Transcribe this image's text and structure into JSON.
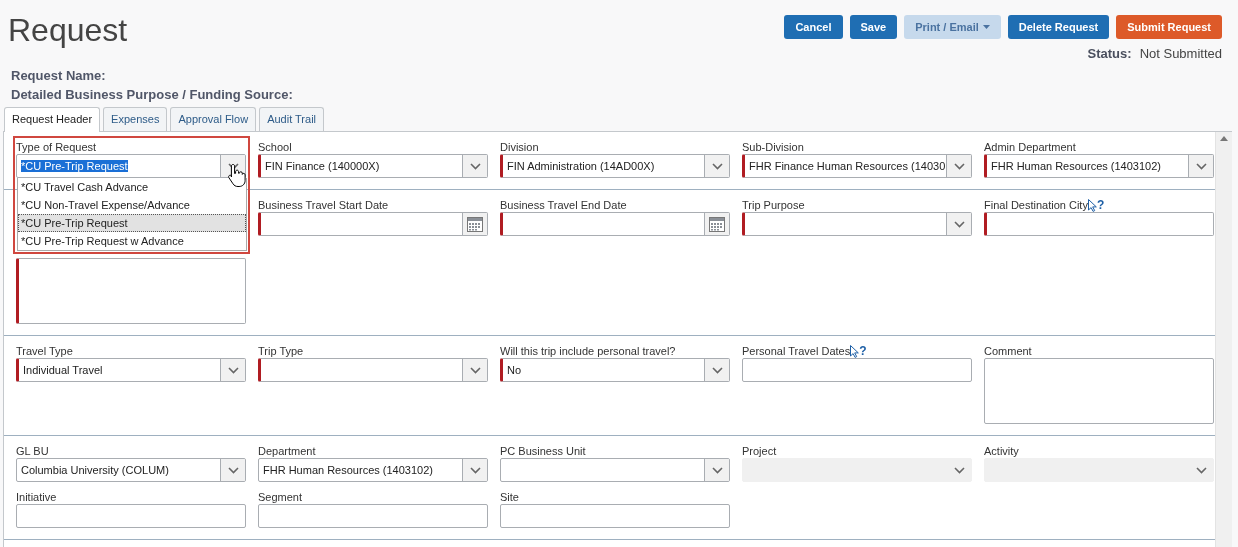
{
  "header": {
    "title": "Request",
    "buttons": [
      {
        "label": "Cancel",
        "kind": "primary",
        "disabled": false,
        "caret": false
      },
      {
        "label": "Save",
        "kind": "primary",
        "disabled": false,
        "caret": false
      },
      {
        "label": "Print / Email",
        "kind": "primary",
        "disabled": true,
        "caret": true
      },
      {
        "label": "Delete Request",
        "kind": "primary",
        "disabled": false,
        "caret": false
      },
      {
        "label": "Submit Request",
        "kind": "danger",
        "disabled": false,
        "caret": false
      }
    ],
    "status_label": "Status:",
    "status_value": "Not Submitted"
  },
  "info": [
    "Request Name:",
    "Detailed Business Purpose / Funding Source:"
  ],
  "tabs": [
    {
      "label": "Request Header",
      "selected": true
    },
    {
      "label": "Expenses",
      "selected": false
    },
    {
      "label": "Approval Flow",
      "selected": false
    },
    {
      "label": "Audit Trail",
      "selected": false
    }
  ],
  "sections": [
    {
      "fields": [
        {
          "kind": "select",
          "label": "Type of Request",
          "value": "*CU Pre-Trip Request",
          "required": false,
          "disabled": false,
          "expanded": true,
          "options": [
            {
              "label": "*CU Travel Cash Advance",
              "selected": false
            },
            {
              "label": "*CU Non-Travel Expense/Advance",
              "selected": false
            },
            {
              "label": "*CU Pre-Trip Request",
              "selected": true
            },
            {
              "label": "*CU Pre-Trip Request w Advance",
              "selected": false
            }
          ]
        },
        {
          "kind": "select",
          "label": "School",
          "value": "FIN Finance (140000X)",
          "required": true,
          "disabled": false
        },
        {
          "kind": "select",
          "label": "Division",
          "value": "FIN Administration (14AD00X)",
          "required": true,
          "disabled": false
        },
        {
          "kind": "select",
          "label": "Sub-Division",
          "value": "FHR Finance Human Resources (14030",
          "required": true,
          "disabled": false
        },
        {
          "kind": "select",
          "label": "Admin Department",
          "value": "FHR Human Resources (1403102)",
          "required": true,
          "disabled": false
        }
      ]
    },
    {
      "fields": [
        {
          "kind": "blank"
        },
        {
          "kind": "date",
          "label": "Business Travel Start Date",
          "required": true,
          "disabled": false
        },
        {
          "kind": "date",
          "label": "Business Travel End Date",
          "required": true,
          "disabled": false
        },
        {
          "kind": "select",
          "label": "Trip Purpose",
          "required": true,
          "disabled": false
        },
        {
          "kind": "text",
          "label": "Final Destination City",
          "help": "?",
          "required": true,
          "disabled": false
        },
        {
          "kind": "textarea",
          "required": true,
          "disabled": false
        }
      ]
    },
    {
      "fields": [
        {
          "kind": "select",
          "label": "Travel Type",
          "value": "Individual Travel",
          "required": true,
          "disabled": false
        },
        {
          "kind": "select",
          "label": "Trip Type",
          "required": true,
          "disabled": false
        },
        {
          "kind": "select",
          "label": "Will this trip include personal travel?",
          "value": "No",
          "required": true,
          "disabled": false
        },
        {
          "kind": "text",
          "label": "Personal Travel Dates",
          "help": "?",
          "required": false,
          "disabled": false
        },
        {
          "kind": "textarea",
          "label": "Comment",
          "required": false,
          "disabled": false
        }
      ]
    },
    {
      "fields": [
        {
          "kind": "select",
          "label": "GL BU",
          "value": "Columbia University (COLUM)",
          "required": false,
          "disabled": false
        },
        {
          "kind": "select",
          "label": "Department",
          "value": "FHR Human Resources (1403102)",
          "required": false,
          "disabled": false
        },
        {
          "kind": "select",
          "label": "PC Business Unit",
          "required": false,
          "disabled": false
        },
        {
          "kind": "select",
          "label": "Project",
          "required": false,
          "disabled": true
        },
        {
          "kind": "select",
          "label": "Activity",
          "required": false,
          "disabled": true
        },
        {
          "kind": "text",
          "label": "Initiative",
          "required": false,
          "disabled": false
        },
        {
          "kind": "text",
          "label": "Segment",
          "required": false,
          "disabled": false
        },
        {
          "kind": "text",
          "label": "Site",
          "required": false,
          "disabled": false
        }
      ]
    }
  ]
}
